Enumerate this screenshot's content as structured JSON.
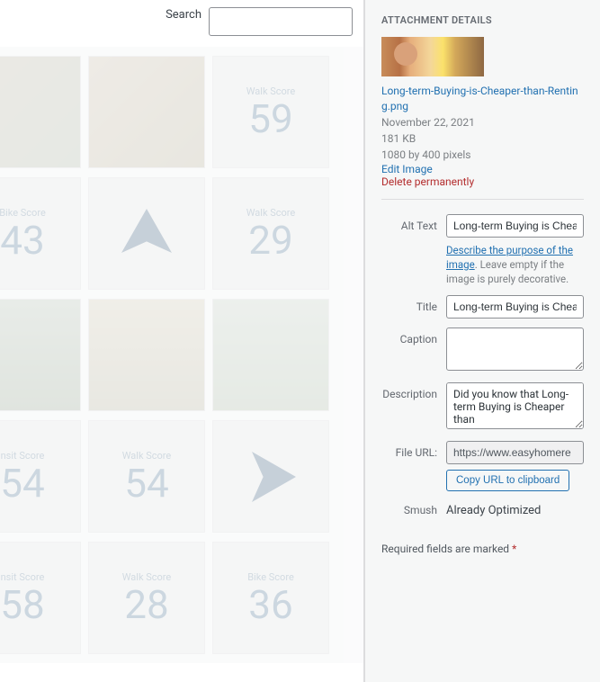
{
  "search": {
    "label": "Search",
    "value": ""
  },
  "grid": {
    "tiles": [
      {
        "type": "photo"
      },
      {
        "type": "photo"
      },
      {
        "type": "score",
        "label": "Walk Score",
        "num": "59"
      },
      {
        "type": "score",
        "label": "Bike Score",
        "num": "43"
      },
      {
        "type": "arrow"
      },
      {
        "type": "score",
        "label": "Walk Score",
        "num": "29"
      },
      {
        "type": "photo"
      },
      {
        "type": "photo"
      },
      {
        "type": "photo"
      },
      {
        "type": "score",
        "label": "nsit Score",
        "num": "54"
      },
      {
        "type": "score",
        "label": "Walk Score",
        "num": "54"
      },
      {
        "type": "arrow"
      },
      {
        "type": "score",
        "label": "nsit Score",
        "num": "58"
      },
      {
        "type": "score",
        "label": "Walk Score",
        "num": "28"
      },
      {
        "type": "score",
        "label": "Bike Score",
        "num": "36"
      }
    ]
  },
  "details": {
    "heading": "ATTACHMENT DETAILS",
    "filename": "Long-term-Buying-is-Cheaper-than-Renting.png",
    "date": "November 22, 2021",
    "filesize": "181 KB",
    "dimensions": "1080 by 400 pixels",
    "edit_link": "Edit Image",
    "delete_link": "Delete permanently",
    "fields": {
      "alt_label": "Alt Text",
      "alt_value": "Long-term Buying is Cheaper than Renting",
      "alt_helper_link": "Describe the purpose of the image",
      "alt_helper_rest": ". Leave empty if the image is purely decorative.",
      "title_label": "Title",
      "title_value": "Long-term Buying is Cheaper than Renting",
      "caption_label": "Caption",
      "caption_value": "",
      "description_label": "Description",
      "description_value": "Did you know that Long-term Buying is Cheaper than",
      "fileurl_label": "File URL:",
      "fileurl_value": "https://www.easyhomere",
      "copy_btn": "Copy URL to clipboard",
      "smush_label": "Smush",
      "smush_value": "Already Optimized"
    },
    "required_note": "Required fields are marked",
    "required_mark": "*"
  }
}
